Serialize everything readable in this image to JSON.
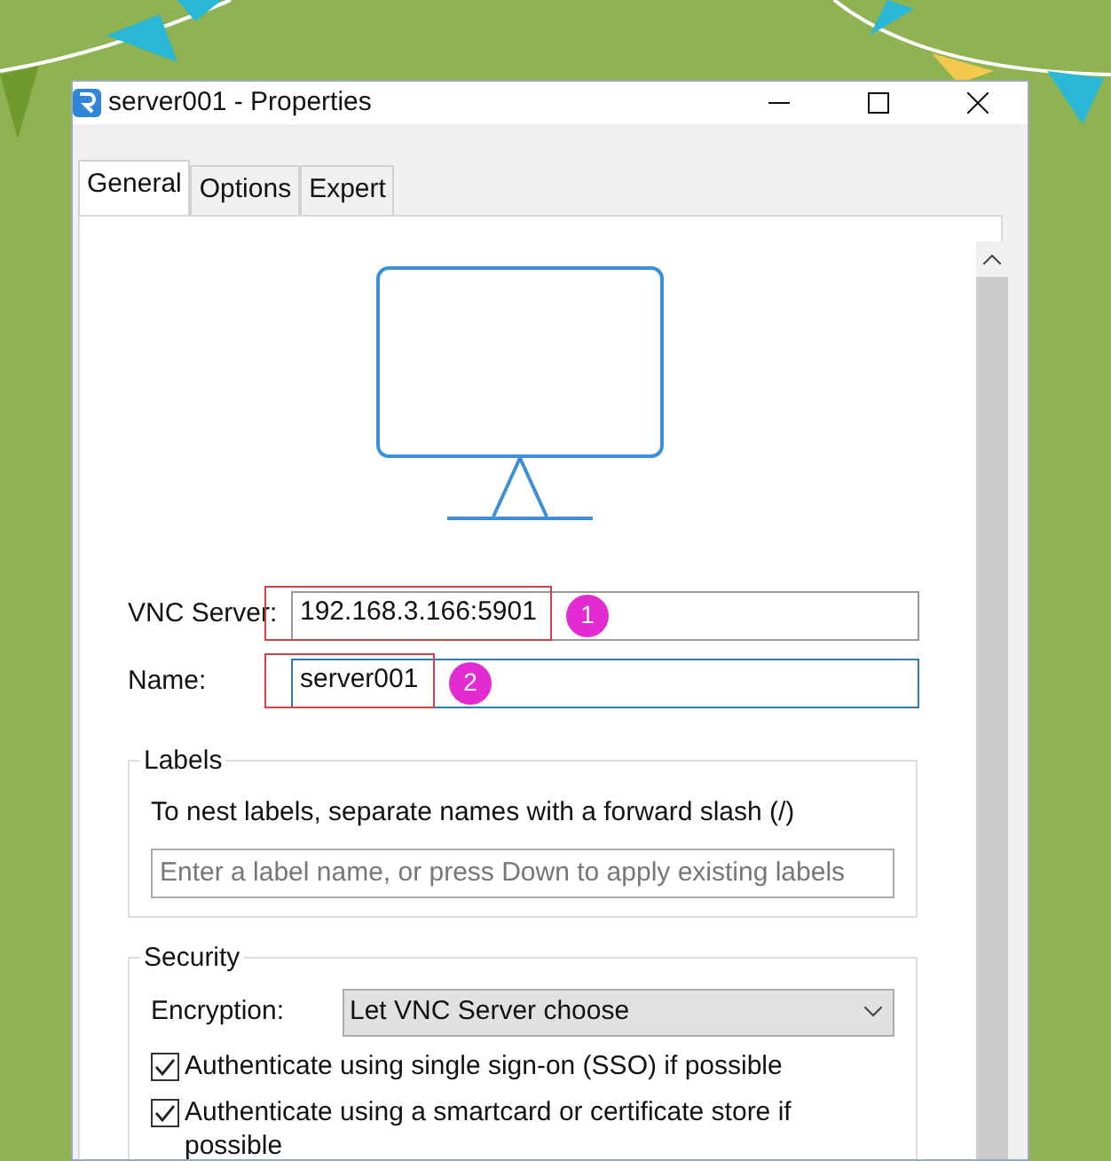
{
  "window": {
    "title": "server001 - Properties"
  },
  "tabs": [
    {
      "label": "General",
      "selected": true
    },
    {
      "label": "Options",
      "selected": false
    },
    {
      "label": "Expert",
      "selected": false
    }
  ],
  "fields": [
    {
      "label": "VNC Server:",
      "value": "192.168.3.166:5901",
      "focused": false,
      "annotation": "1"
    },
    {
      "label": "Name:",
      "value": "server001",
      "focused": true,
      "annotation": "2"
    }
  ],
  "labels_group": {
    "title": "Labels",
    "hint": "To nest labels, separate names with a forward slash (/)",
    "placeholder": "Enter a label name, or press Down to apply existing labels"
  },
  "security": {
    "title": "Security",
    "encryption": {
      "label": "Encryption:",
      "value": "Let VNC Server choose"
    },
    "options": [
      {
        "label": "Authenticate using single sign-on (SSO) if possible",
        "checked": true
      },
      {
        "label": "Authenticate using a smartcard or certificate store if possible",
        "checked": true
      }
    ]
  }
}
